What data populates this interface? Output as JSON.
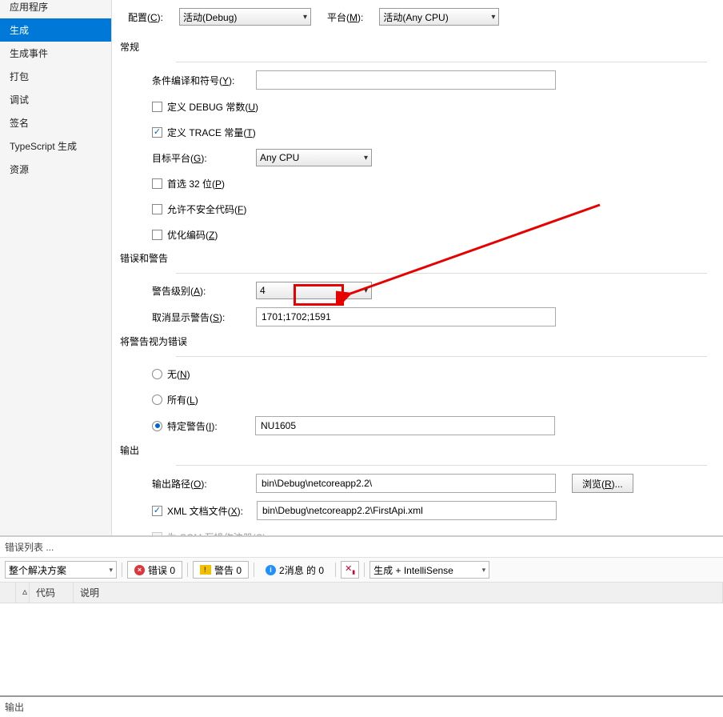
{
  "sidebar": {
    "items": [
      {
        "label": "应用程序"
      },
      {
        "label": "生成"
      },
      {
        "label": "生成事件"
      },
      {
        "label": "打包"
      },
      {
        "label": "调试"
      },
      {
        "label": "签名"
      },
      {
        "label": "TypeScript 生成"
      },
      {
        "label": "资源"
      }
    ]
  },
  "top": {
    "config_label_prefix": "配置(",
    "config_label_key": "C",
    "config_label_suffix": "):",
    "config_value": "活动(Debug)",
    "platform_label_prefix": "平台(",
    "platform_label_key": "M",
    "platform_label_suffix": "):",
    "platform_value": "活动(Any CPU)"
  },
  "sections": {
    "general": "常规",
    "errors_warnings": "错误和警告",
    "treat_as_errors": "将警告视为错误",
    "output": "输出"
  },
  "general": {
    "compile_symbols_prefix": "条件编译和符号(",
    "compile_symbols_key": "Y",
    "compile_symbols_suffix": "):",
    "debug_const_prefix": "定义 DEBUG 常数(",
    "debug_const_key": "U",
    "debug_const_suffix": ")",
    "trace_const_prefix": "定义 TRACE 常量(",
    "trace_const_key": "T",
    "trace_const_suffix": ")",
    "target_platform_prefix": "目标平台(",
    "target_platform_key": "G",
    "target_platform_suffix": "):",
    "target_platform_value": "Any CPU",
    "prefer_32_prefix": "首选 32 位(",
    "prefer_32_key": "P",
    "prefer_32_suffix": ")",
    "unsafe_prefix": "允许不安全代码(",
    "unsafe_key": "F",
    "unsafe_suffix": ")",
    "optimize_prefix": "优化编码(",
    "optimize_key": "Z",
    "optimize_suffix": ")"
  },
  "warnings": {
    "level_prefix": "警告级别(",
    "level_key": "A",
    "level_suffix": "):",
    "level_value": "4",
    "suppress_prefix": "取消显示警告(",
    "suppress_key": "S",
    "suppress_suffix": "):",
    "suppress_value": "1701;1702;1591"
  },
  "treat": {
    "none_prefix": "无(",
    "none_key": "N",
    "none_suffix": ")",
    "all_prefix": "所有(",
    "all_key": "L",
    "all_suffix": ")",
    "specific_prefix": "特定警告(",
    "specific_key": "I",
    "specific_suffix": "):",
    "specific_value": "NU1605"
  },
  "output": {
    "path_prefix": "输出路径(",
    "path_key": "O",
    "path_suffix": "):",
    "path_value": "bin\\Debug\\netcoreapp2.2\\",
    "browse_prefix": "浏览(",
    "browse_key": "R",
    "browse_suffix": ")...",
    "xml_prefix": "XML 文档文件(",
    "xml_key": "X",
    "xml_suffix": "):",
    "xml_value": "bin\\Debug\\netcoreapp2.2\\FirstApi.xml",
    "com_prefix": "为 COM 互操作注册(",
    "com_key": "C",
    "com_suffix": ")"
  },
  "error_list": {
    "title": "错误列表 ...",
    "scope": "整个解决方案",
    "errors": "错误 0",
    "warnings": "警告 0",
    "messages": "2消息 的 0",
    "filter_source": "生成 + IntelliSense",
    "col_code": "代码",
    "col_desc": "说明"
  },
  "output_panel": {
    "title": "输出"
  }
}
